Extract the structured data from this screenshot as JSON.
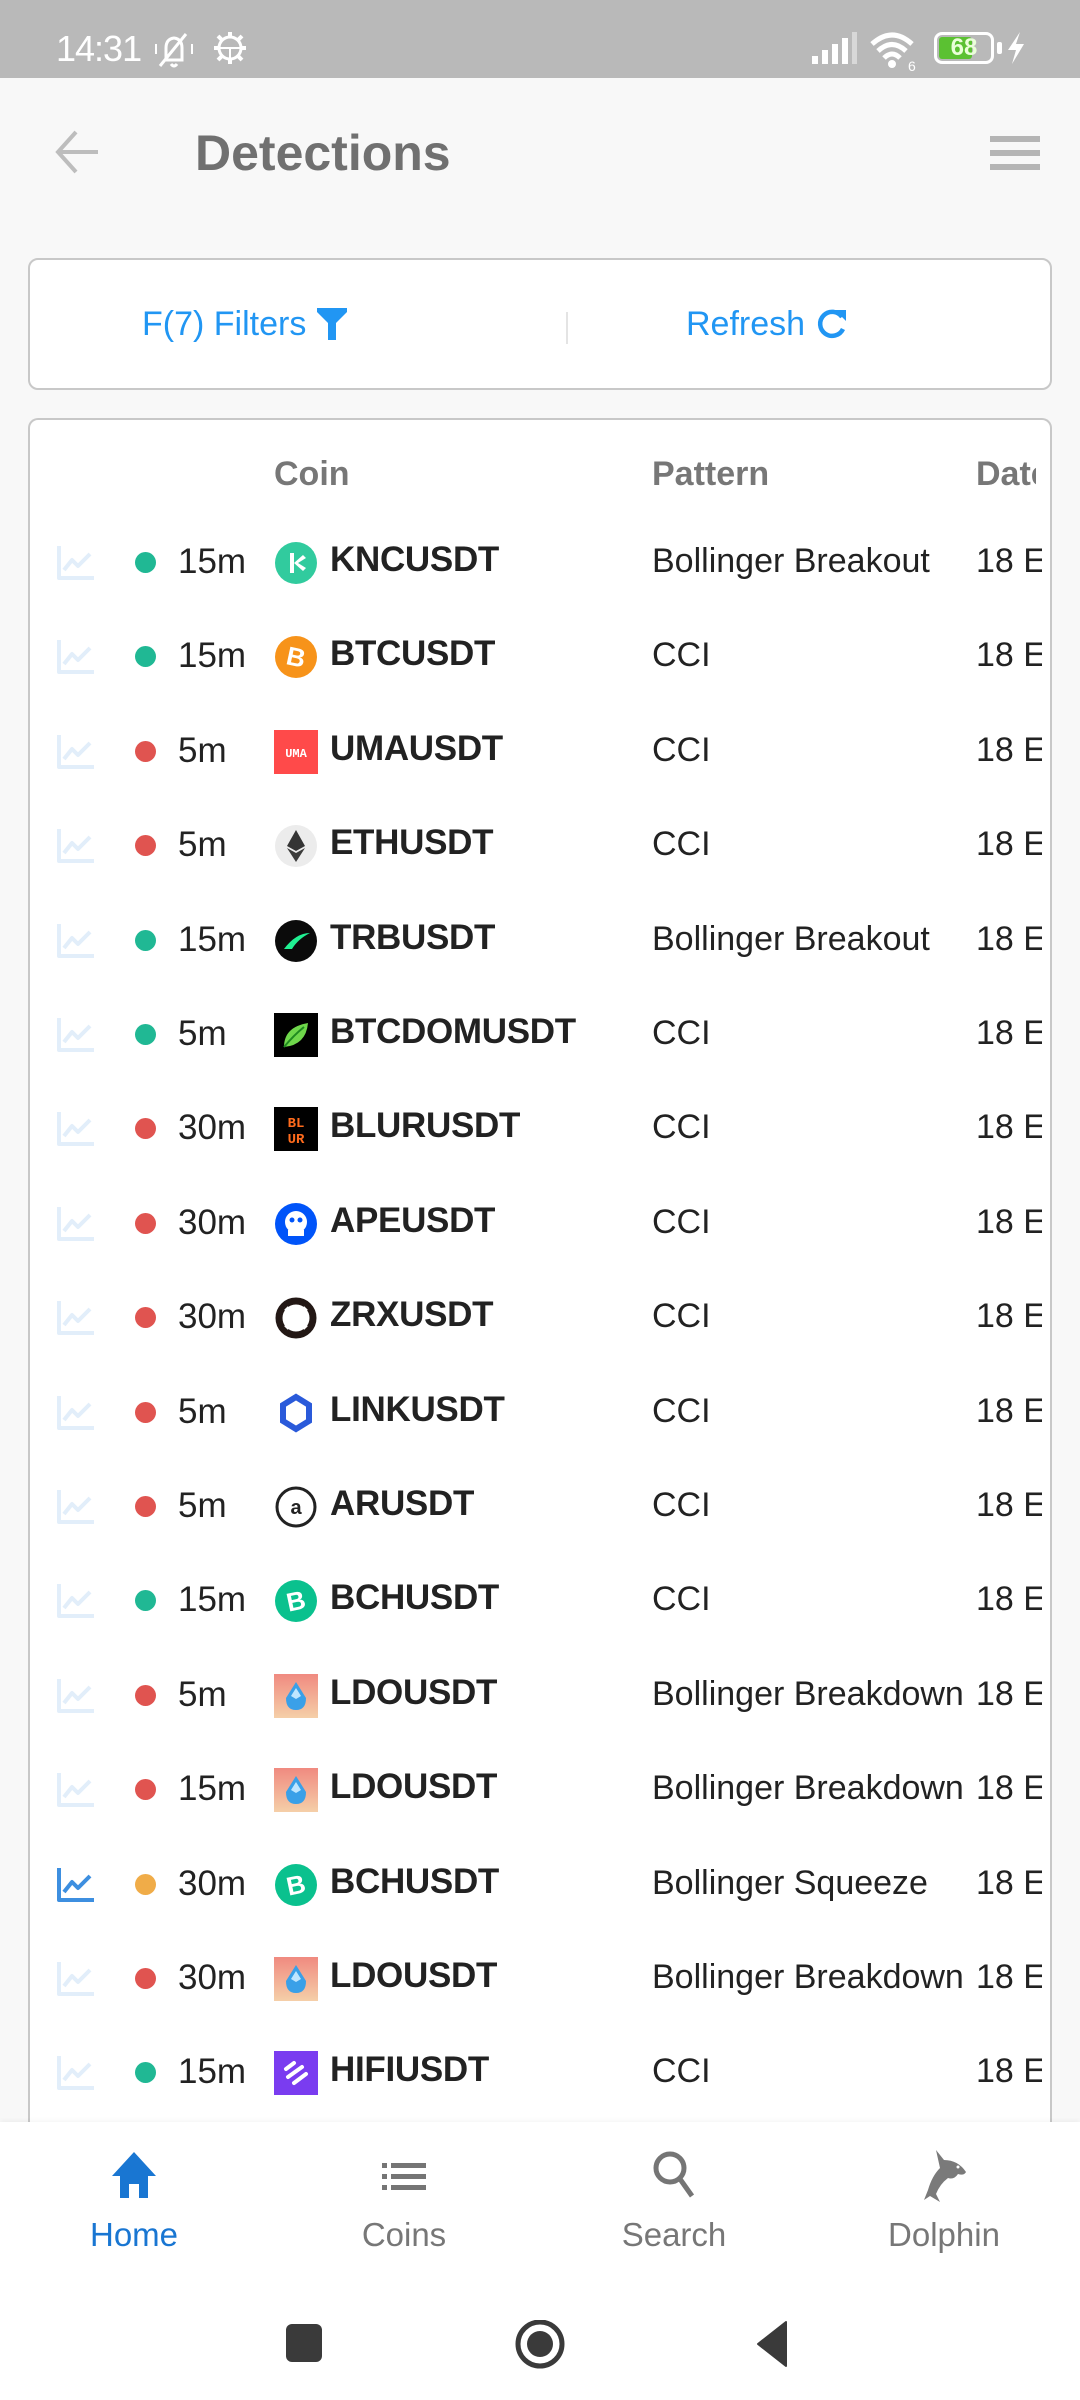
{
  "status_bar": {
    "time": "14:31",
    "battery_level": "68",
    "battery_fraction": 0.68,
    "wifi_label": "6",
    "icons": [
      "bell-off-icon",
      "debug-gear-icon",
      "signal-icon",
      "wifi-icon",
      "battery-icon",
      "charging-bolt-icon"
    ]
  },
  "header": {
    "title": "Detections",
    "back_icon": "arrow-left-icon",
    "menu_icon": "hamburger-menu-icon"
  },
  "actions": {
    "filters_label": "F(7) Filters",
    "filters_icon": "funnel-icon",
    "refresh_label": "Refresh",
    "refresh_icon": "refresh-icon",
    "accent_color": "#2196f3"
  },
  "table": {
    "columns": [
      "Coin",
      "Pattern",
      "Date"
    ],
    "status_colors": {
      "green": "#20b894",
      "red": "#e05450",
      "orange": "#f0ac48"
    },
    "rows": [
      {
        "chart_active": false,
        "status": "green",
        "timeframe": "15m",
        "coin": "KNCUSDT",
        "logo": "knc",
        "pattern": "Bollinger Breakout",
        "date": "18 E"
      },
      {
        "chart_active": false,
        "status": "green",
        "timeframe": "15m",
        "coin": "BTCUSDT",
        "logo": "btc",
        "pattern": "CCI",
        "date": "18 E"
      },
      {
        "chart_active": false,
        "status": "red",
        "timeframe": "5m",
        "coin": "UMAUSDT",
        "logo": "uma",
        "pattern": "CCI",
        "date": "18 E"
      },
      {
        "chart_active": false,
        "status": "red",
        "timeframe": "5m",
        "coin": "ETHUSDT",
        "logo": "eth",
        "pattern": "CCI",
        "date": "18 E"
      },
      {
        "chart_active": false,
        "status": "green",
        "timeframe": "15m",
        "coin": "TRBUSDT",
        "logo": "trb",
        "pattern": "Bollinger Breakout",
        "date": "18 E"
      },
      {
        "chart_active": false,
        "status": "green",
        "timeframe": "5m",
        "coin": "BTCDOMUSDT",
        "logo": "btcdom",
        "pattern": "CCI",
        "date": "18 E"
      },
      {
        "chart_active": false,
        "status": "red",
        "timeframe": "30m",
        "coin": "BLURUSDT",
        "logo": "blur",
        "pattern": "CCI",
        "date": "18 E"
      },
      {
        "chart_active": false,
        "status": "red",
        "timeframe": "30m",
        "coin": "APEUSDT",
        "logo": "ape",
        "pattern": "CCI",
        "date": "18 E"
      },
      {
        "chart_active": false,
        "status": "red",
        "timeframe": "30m",
        "coin": "ZRXUSDT",
        "logo": "zrx",
        "pattern": "CCI",
        "date": "18 E"
      },
      {
        "chart_active": false,
        "status": "red",
        "timeframe": "5m",
        "coin": "LINKUSDT",
        "logo": "link",
        "pattern": "CCI",
        "date": "18 E"
      },
      {
        "chart_active": false,
        "status": "red",
        "timeframe": "5m",
        "coin": "ARUSDT",
        "logo": "ar",
        "pattern": "CCI",
        "date": "18 E"
      },
      {
        "chart_active": false,
        "status": "green",
        "timeframe": "15m",
        "coin": "BCHUSDT",
        "logo": "bch",
        "pattern": "CCI",
        "date": "18 E"
      },
      {
        "chart_active": false,
        "status": "red",
        "timeframe": "5m",
        "coin": "LDOUSDT",
        "logo": "ldo",
        "pattern": "Bollinger Breakdown",
        "date": "18 E"
      },
      {
        "chart_active": false,
        "status": "red",
        "timeframe": "15m",
        "coin": "LDOUSDT",
        "logo": "ldo",
        "pattern": "Bollinger Breakdown",
        "date": "18 E"
      },
      {
        "chart_active": true,
        "status": "orange",
        "timeframe": "30m",
        "coin": "BCHUSDT",
        "logo": "bch",
        "pattern": "Bollinger Squeeze",
        "date": "18 E"
      },
      {
        "chart_active": false,
        "status": "red",
        "timeframe": "30m",
        "coin": "LDOUSDT",
        "logo": "ldo",
        "pattern": "Bollinger Breakdown",
        "date": "18 E"
      },
      {
        "chart_active": false,
        "status": "green",
        "timeframe": "15m",
        "coin": "HIFIUSDT",
        "logo": "hifi",
        "pattern": "CCI",
        "date": "18 E"
      }
    ]
  },
  "bottom_nav": {
    "active": "home",
    "active_color": "#1976d2",
    "items": [
      {
        "id": "home",
        "label": "Home",
        "icon": "home-icon"
      },
      {
        "id": "coins",
        "label": "Coins",
        "icon": "list-icon"
      },
      {
        "id": "search",
        "label": "Search",
        "icon": "search-icon"
      },
      {
        "id": "dolphin",
        "label": "Dolphin",
        "icon": "dolphin-icon"
      }
    ]
  },
  "system_nav": {
    "buttons": [
      "recents-button",
      "home-button",
      "back-button"
    ]
  }
}
